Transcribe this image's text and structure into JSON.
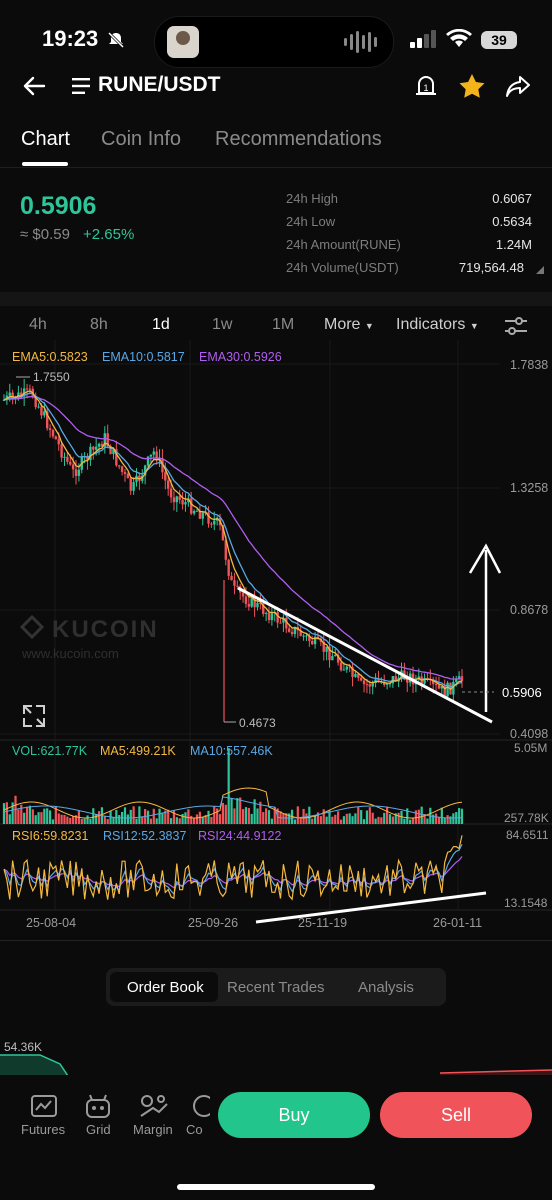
{
  "status_bar": {
    "time": "19:23",
    "battery": "39"
  },
  "header": {
    "pair": "RUNE/USDT"
  },
  "tabs": [
    "Chart",
    "Coin Info",
    "Recommendations"
  ],
  "price": {
    "last": "0.5906",
    "approx": "≈ $0.59",
    "change": "+2.65%"
  },
  "stats": [
    {
      "label": "24h High",
      "value": "0.6067"
    },
    {
      "label": "24h Low",
      "value": "0.5634"
    },
    {
      "label": "24h Amount(RUNE)",
      "value": "1.24M"
    },
    {
      "label": "24h Volume(USDT)",
      "value": "719,564.48"
    }
  ],
  "intervals": [
    "4h",
    "8h",
    "1d",
    "1w",
    "1M"
  ],
  "more_label": "More",
  "indicators_label": "Indicators",
  "chart": {
    "ema": [
      "EMA5:0.5823",
      "EMA10:0.5817",
      "EMA30:0.5926"
    ],
    "y_labels": [
      "1.7838",
      "1.3258",
      "0.8678",
      "0.4098"
    ],
    "high_label": "1.7550",
    "low_label": "0.4673",
    "current_price": "0.5906",
    "watermark": "KUCOIN",
    "watermark_url": "www.kucoin.com",
    "vol": [
      "VOL:621.77K",
      "MA5:499.21K",
      "MA10:557.46K"
    ],
    "vol_labels": [
      "5.05M",
      "257.78K"
    ],
    "rsi": [
      "RSI6:59.8231",
      "RSI12:52.3837",
      "RSI24:44.9122"
    ],
    "rsi_labels": [
      "84.6511",
      "13.1548"
    ],
    "x_labels": [
      "25-08-04",
      "25-09-26",
      "25-11-19",
      "26-01-11"
    ]
  },
  "colors": {
    "up": "#2ec59a",
    "down": "#f0545a",
    "ema5": "#f5b841",
    "ema10": "#5aa8e6",
    "ema30": "#b05ef0"
  },
  "bottom_tabs": [
    "Order Book",
    "Recent Trades",
    "Analysis"
  ],
  "depth_label": "54.36K",
  "bottom_nav": [
    "Futures",
    "Grid",
    "Margin",
    "Co"
  ],
  "buy_label": "Buy",
  "sell_label": "Sell"
}
